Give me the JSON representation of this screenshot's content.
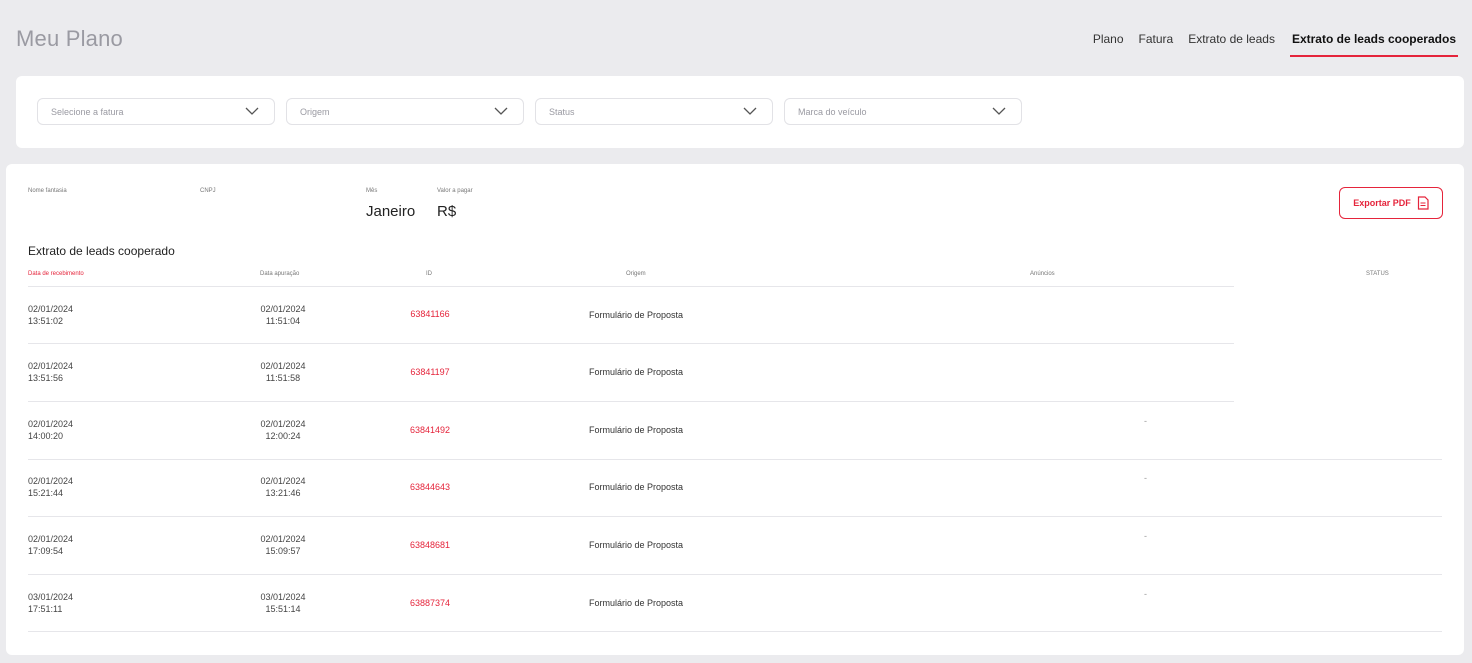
{
  "header": {
    "title": "Meu Plano",
    "nav": [
      {
        "label": "Plano",
        "active": false
      },
      {
        "label": "Fatura",
        "active": false
      },
      {
        "label": "Extrato de leads",
        "active": false
      },
      {
        "label": "Extrato de leads cooperados",
        "active": true
      }
    ]
  },
  "filters": [
    {
      "placeholder": "Selecione a fatura",
      "icon": "chevron-down-icon"
    },
    {
      "placeholder": "Origem",
      "icon": "chevron-down-icon"
    },
    {
      "placeholder": "Status",
      "icon": "chevron-down-icon"
    },
    {
      "placeholder": "Marca do veículo",
      "icon": "chevron-down-icon"
    }
  ],
  "info": {
    "nome_fantasia_label": "Nome fantasia",
    "cnpj_label": "CNPJ",
    "mes_label": "Mês",
    "mes_value": "Janeiro",
    "valor_label": "Valor a pagar",
    "valor_value": "R$"
  },
  "export_button": {
    "label": "Exportar PDF",
    "icon": "pdf-file-icon"
  },
  "table": {
    "title": "Extrato de leads cooperado",
    "columns": [
      "Data de recebimento",
      "Data apuração",
      "ID",
      "Origem",
      "Anúncios",
      "STATUS"
    ],
    "rows": [
      {
        "recebimento_date": "02/01/2024",
        "recebimento_time": "13:51:02",
        "apuracao_date": "02/01/2024",
        "apuracao_time": "11:51:04",
        "id": "63841166",
        "origem": "Formulário de Proposta",
        "anuncios": ""
      },
      {
        "recebimento_date": "02/01/2024",
        "recebimento_time": "13:51:56",
        "apuracao_date": "02/01/2024",
        "apuracao_time": "11:51:58",
        "id": "63841197",
        "origem": "Formulário de Proposta",
        "anuncios": ""
      },
      {
        "recebimento_date": "02/01/2024",
        "recebimento_time": "14:00:20",
        "apuracao_date": "02/01/2024",
        "apuracao_time": "12:00:24",
        "id": "63841492",
        "origem": "Formulário de Proposta",
        "anuncios": "-"
      },
      {
        "recebimento_date": "02/01/2024",
        "recebimento_time": "15:21:44",
        "apuracao_date": "02/01/2024",
        "apuracao_time": "13:21:46",
        "id": "63844643",
        "origem": "Formulário de Proposta",
        "anuncios": "-"
      },
      {
        "recebimento_date": "02/01/2024",
        "recebimento_time": "17:09:54",
        "apuracao_date": "02/01/2024",
        "apuracao_time": "15:09:57",
        "id": "63848681",
        "origem": "Formulário de Proposta",
        "anuncios": "-"
      },
      {
        "recebimento_date": "03/01/2024",
        "recebimento_time": "17:51:11",
        "apuracao_date": "03/01/2024",
        "apuracao_time": "15:51:14",
        "id": "63887374",
        "origem": "Formulário de Proposta",
        "anuncios": "-"
      }
    ]
  },
  "colors": {
    "accent": "#e5243b",
    "background": "#ebebee",
    "panel": "#ffffff"
  }
}
